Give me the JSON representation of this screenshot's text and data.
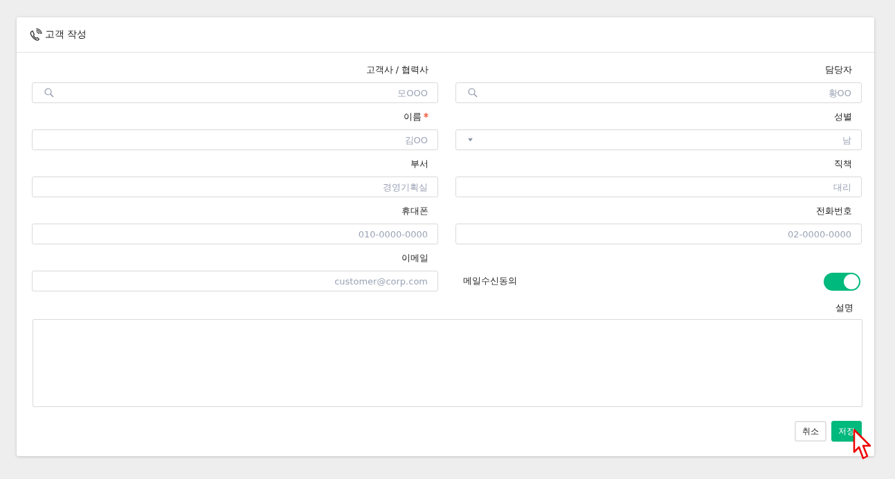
{
  "window": {
    "title": "고객 작성"
  },
  "fields": [
    {
      "kind": "search",
      "label": "고객사 / 협력사",
      "required": false,
      "placeholder": "모OOO"
    },
    {
      "kind": "search",
      "label": "담당자",
      "required": false,
      "placeholder": "황OO"
    },
    {
      "kind": "text",
      "label": "이름",
      "required": true,
      "placeholder": "김OO"
    },
    {
      "kind": "select",
      "label": "성별",
      "required": false,
      "placeholder": "남"
    },
    {
      "kind": "text",
      "label": "부서",
      "required": false,
      "placeholder": "경영기획실"
    },
    {
      "kind": "text",
      "label": "직책",
      "required": false,
      "placeholder": "대리"
    },
    {
      "kind": "text",
      "label": "휴대폰",
      "required": false,
      "placeholder": "010-0000-0000"
    },
    {
      "kind": "text",
      "label": "전화번호",
      "required": false,
      "placeholder": "02-0000-0000"
    },
    {
      "kind": "text",
      "label": "이메일",
      "required": false,
      "placeholder": "customer@corp.com"
    },
    {
      "kind": "toggle",
      "label": "메일수신동의",
      "on": true
    }
  ],
  "description": {
    "label": "설명"
  },
  "buttons": [
    {
      "label": "취소",
      "kind": "secondary"
    },
    {
      "label": "저장",
      "kind": "primary"
    }
  ]
}
